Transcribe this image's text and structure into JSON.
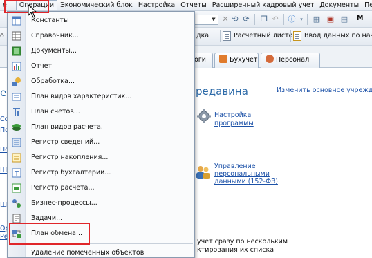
{
  "menubar": {
    "items": [
      "Операции",
      "Экономический блок",
      "Настройка",
      "Отчеты",
      "Расширенный кадровый учет",
      "Документы",
      "Персо"
    ],
    "left_cut": "е"
  },
  "toolbar2": {
    "left_cut": "о",
    "btn1_label": "дка",
    "btn2_label": "Расчетный листок",
    "btn3_label": "Ввод данных по начи"
  },
  "tabs": [
    {
      "label": "оги"
    },
    {
      "label": "Бухучет"
    },
    {
      "label": "Персонал"
    }
  ],
  "content": {
    "heading": "редавина",
    "right_link": "Изменить основное учрежд",
    "nastroyka_link": [
      "Настройка",
      "программы"
    ],
    "upravlenie_link": [
      "Управление",
      "персональными",
      "данными (152-ФЗ)"
    ],
    "bottom_text": [
      "учет сразу по нескольким",
      "ктирования их списка"
    ],
    "left_cuts": [
      "е",
      "Сот",
      "По",
      "Под",
      "Ш",
      "Шт",
      "Ор",
      "Ре"
    ]
  },
  "menu": {
    "items": [
      {
        "label": "Константы",
        "icon": "constants-icon"
      },
      {
        "label": "Справочник...",
        "icon": "catalog-icon"
      },
      {
        "label": "Документы...",
        "icon": "documents-icon"
      },
      {
        "label": "Отчет...",
        "icon": "report-icon"
      },
      {
        "label": "Обработка...",
        "icon": "processing-icon"
      },
      {
        "label": "План видов характеристик...",
        "icon": "characteristics-plan-icon"
      },
      {
        "label": "План счетов...",
        "icon": "chart-of-accounts-icon"
      },
      {
        "label": "План видов расчета...",
        "icon": "calculation-types-icon"
      },
      {
        "label": "Регистр сведений...",
        "icon": "info-register-icon"
      },
      {
        "label": "Регистр накопления...",
        "icon": "accumulation-register-icon"
      },
      {
        "label": "Регистр бухгалтерии...",
        "icon": "accounting-register-icon"
      },
      {
        "label": "Регистр расчета...",
        "icon": "calculation-register-icon"
      },
      {
        "label": "Бизнес-процессы...",
        "icon": "business-processes-icon"
      },
      {
        "label": "Задачи...",
        "icon": "tasks-icon"
      },
      {
        "label": "План обмена...",
        "icon": "exchange-plan-icon"
      },
      {
        "label": "Удаление помеченных объектов",
        "icon": ""
      }
    ]
  },
  "colors": {
    "highlight": "#e0262a",
    "link": "#1d52a8",
    "heading": "#2c6aa8"
  }
}
